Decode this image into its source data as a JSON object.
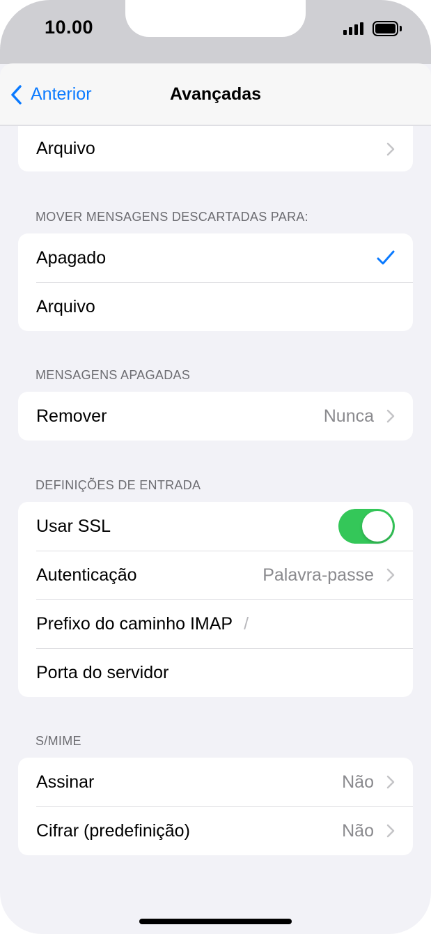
{
  "status_bar": {
    "time": "10.00"
  },
  "nav": {
    "back_label": "Anterior",
    "title": "Avançadas"
  },
  "archive_row": {
    "label": "Arquivo"
  },
  "move_section": {
    "header": "MOVER MENSAGENS DESCARTADAS PARA:",
    "options": [
      {
        "label": "Apagado",
        "selected": true
      },
      {
        "label": "Arquivo",
        "selected": false
      }
    ]
  },
  "deleted_section": {
    "header": "MENSAGENS APAGADAS",
    "remove": {
      "label": "Remover",
      "value": "Nunca"
    }
  },
  "incoming_section": {
    "header": "DEFINIÇÕES DE ENTRADA",
    "ssl": {
      "label": "Usar SSL",
      "enabled": true
    },
    "auth": {
      "label": "Autenticação",
      "value": "Palavra-passe"
    },
    "imap": {
      "label": "Prefixo do caminho IMAP",
      "placeholder": "/"
    },
    "port": {
      "label": "Porta do servidor"
    }
  },
  "smime_section": {
    "header": "S/MIME",
    "sign": {
      "label": "Assinar",
      "value": "Não"
    },
    "encrypt": {
      "label": "Cifrar (predefinição)",
      "value": "Não"
    }
  },
  "colors": {
    "accent": "#0a7aff",
    "toggle_on": "#34c759",
    "background": "#f2f2f7"
  }
}
